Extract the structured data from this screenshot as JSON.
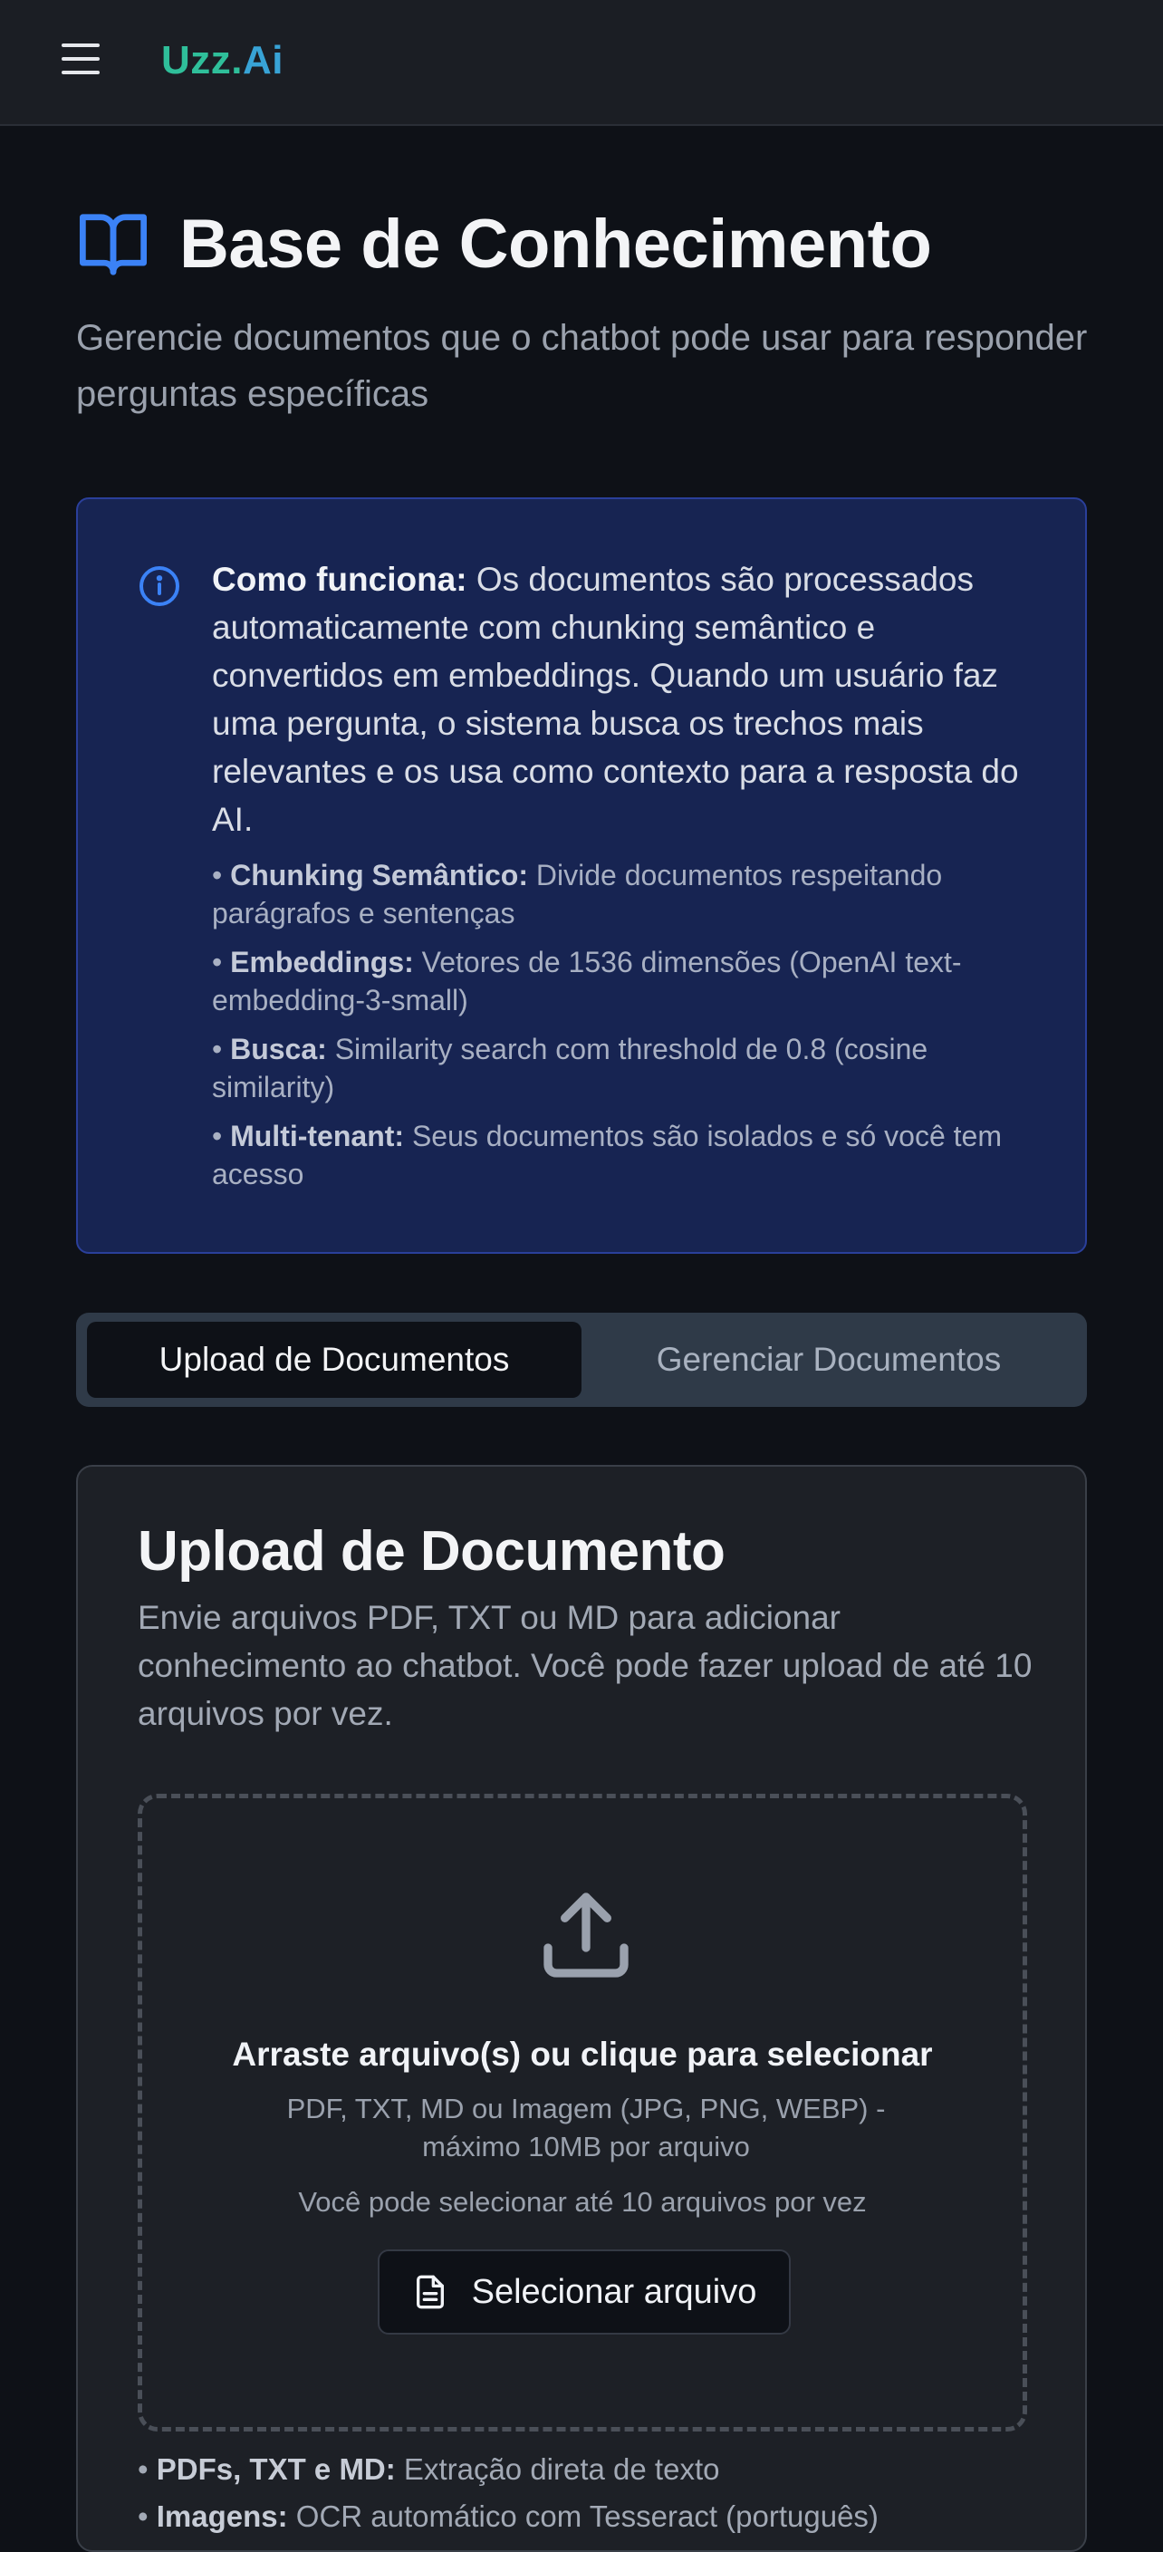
{
  "header": {
    "brand_part1": "Uzz.",
    "brand_part2": "Ai",
    "menu_icon": "hamburger-menu-icon"
  },
  "page": {
    "icon": "open-book-icon",
    "title": "Base de Conhecimento",
    "subtitle": "Gerencie documentos que o chatbot pode usar para responder perguntas específicas"
  },
  "info": {
    "icon": "info-circle-icon",
    "lead": "Como funciona:",
    "text": " Os documentos são processados automaticamente com chunking semântico e convertidos em embeddings. Quando um usuário faz uma pergunta, o sistema busca os trechos mais relevantes e os usa como contexto para a resposta do AI.",
    "items": [
      {
        "label": "Chunking Semântico:",
        "text": " Divide documentos respeitando parágrafos e sentenças"
      },
      {
        "label": "Embeddings:",
        "text": " Vetores de 1536 dimensões (OpenAI text-embedding-3-small)"
      },
      {
        "label": "Busca:",
        "text": " Similarity search com threshold de 0.8 (cosine similarity)"
      },
      {
        "label": "Multi-tenant:",
        "text": " Seus documentos são isolados e só você tem acesso"
      }
    ]
  },
  "tabs": {
    "upload_label": "Upload de Documentos",
    "manage_label": "Gerenciar Documentos",
    "active": "upload"
  },
  "upload_card": {
    "title": "Upload de Documento",
    "description": "Envie arquivos PDF, TXT ou MD para adicionar conhecimento ao chatbot. Você pode fazer upload de até 10 arquivos por vez.",
    "dropzone": {
      "icon": "upload-icon",
      "title": "Arraste arquivo(s) ou clique para selecionar",
      "formats": "PDF, TXT, MD ou Imagem (JPG, PNG, WEBP) - máximo 10MB por arquivo",
      "limit": "Você pode selecionar até 10 arquivos por vez",
      "button_icon": "file-text-icon",
      "button_label": "Selecionar arquivo"
    },
    "notes": [
      {
        "label": "PDFs, TXT e MD:",
        "text": " Extração direta de texto"
      },
      {
        "label": "Imagens:",
        "text": " OCR automático com Tesseract (português)"
      }
    ]
  },
  "colors": {
    "background": "#0e1117",
    "brand_green": "#2fbf9a",
    "brand_blue": "#38a3d6",
    "info_bg": "#172452",
    "accent_blue": "#3b82f6"
  }
}
